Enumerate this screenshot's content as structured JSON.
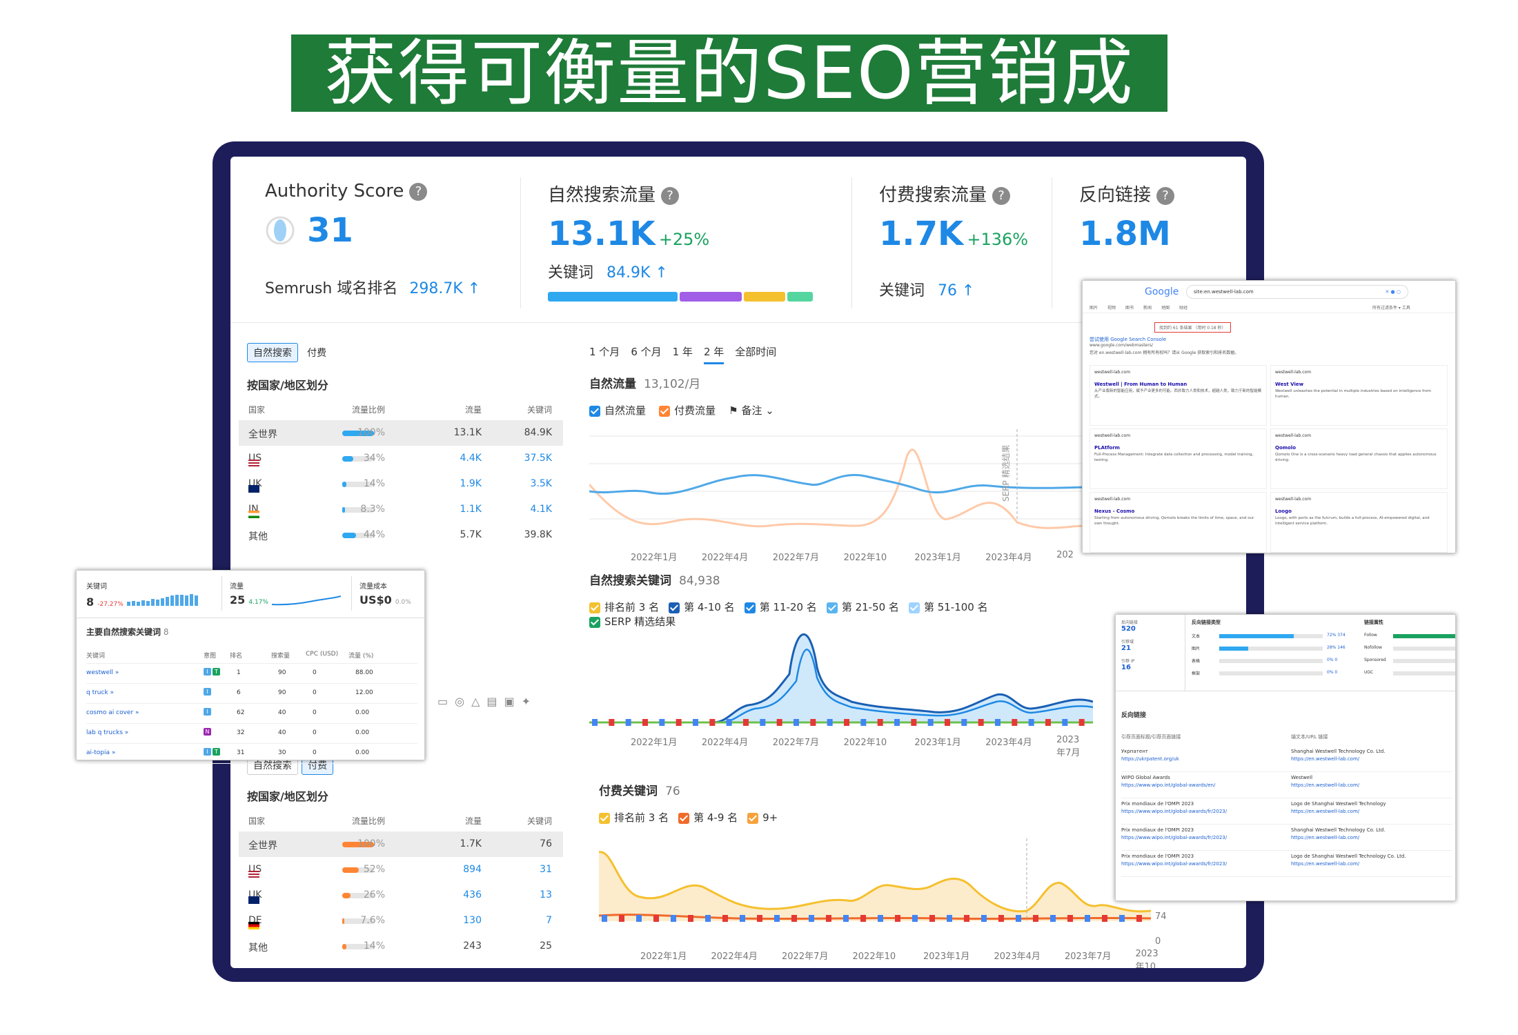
{
  "banner": {
    "title": "获得可衡量的SEO营销成果"
  },
  "colors": {
    "brand_green": "#1e7b38",
    "frame": "#1d1d5a",
    "accent_blue": "#1e88e5",
    "paid_orange": "#ff8534"
  },
  "metrics": {
    "authority": {
      "label": "Authority Score",
      "value": "31",
      "rank_label": "Semrush 域名排名",
      "rank_value": "298.7K"
    },
    "organic": {
      "label": "自然搜索流量",
      "value": "13.1K",
      "delta": "+25%",
      "kw_label": "关键词",
      "kw_value": "84.9K"
    },
    "paid": {
      "label": "付费搜索流量",
      "value": "1.7K",
      "delta": "+136%",
      "kw_label": "关键词",
      "kw_value": "76"
    },
    "backlinks": {
      "label": "反向链接",
      "value": "1.8M"
    },
    "organic_kw_bar": [
      {
        "color": "#2fa8f0",
        "share": 0.5
      },
      {
        "color": "#a15ee6",
        "share": 0.24
      },
      {
        "color": "#f5c02e",
        "share": 0.16
      },
      {
        "color": "#55d6a0",
        "share": 0.1
      }
    ]
  },
  "organic_table": {
    "tabs": [
      "自然搜索",
      "付费"
    ],
    "title": "按国家/地区划分",
    "headers": [
      "国家",
      "流量比例",
      "流量",
      "关键词"
    ],
    "rows": [
      {
        "country": "全世界",
        "flag": "",
        "share": "100%",
        "traffic": "13.1K",
        "keywords": "84.9K",
        "pct": 1.0
      },
      {
        "country": "US",
        "flag": "us",
        "share": "34%",
        "traffic": "4.4K",
        "keywords": "37.5K",
        "pct": 0.34
      },
      {
        "country": "UK",
        "flag": "uk",
        "share": "14%",
        "traffic": "1.9K",
        "keywords": "3.5K",
        "pct": 0.14
      },
      {
        "country": "IN",
        "flag": "in",
        "share": "8.3%",
        "traffic": "1.1K",
        "keywords": "4.1K",
        "pct": 0.083
      },
      {
        "country": "其他",
        "flag": "",
        "share": "44%",
        "traffic": "5.7K",
        "keywords": "39.8K",
        "pct": 0.44
      }
    ]
  },
  "paid_table": {
    "tabs": [
      "自然搜索",
      "付费"
    ],
    "title": "按国家/地区划分",
    "headers": [
      "国家",
      "流量比例",
      "流量",
      "关键词"
    ],
    "rows": [
      {
        "country": "全世界",
        "flag": "",
        "share": "100%",
        "traffic": "1.7K",
        "keywords": "76",
        "pct": 1.0
      },
      {
        "country": "US",
        "flag": "us",
        "share": "52%",
        "traffic": "894",
        "keywords": "31",
        "pct": 0.52
      },
      {
        "country": "UK",
        "flag": "uk",
        "share": "26%",
        "traffic": "436",
        "keywords": "13",
        "pct": 0.26
      },
      {
        "country": "DE",
        "flag": "de",
        "share": "7.6%",
        "traffic": "130",
        "keywords": "7",
        "pct": 0.076
      },
      {
        "country": "其他",
        "flag": "",
        "share": "14%",
        "traffic": "243",
        "keywords": "25",
        "pct": 0.14
      }
    ]
  },
  "time_tabs": [
    "1 个月",
    "6 个月",
    "1 年",
    "2 年",
    "全部时间"
  ],
  "time_tab_active": "2 年",
  "traffic_chart": {
    "title": "自然流量",
    "subtitle": "13,102/月",
    "legend": [
      "自然流量",
      "付费流量"
    ],
    "notes_label": "备注",
    "serp_label": "SERP 精选结果",
    "xlabels": [
      "2022年1月",
      "2022年4月",
      "2022年7月",
      "2022年10",
      "2023年1月",
      "2023年4月",
      "202"
    ]
  },
  "kw_chart": {
    "title": "自然搜索关键词",
    "subtitle": "84,938",
    "legend": [
      "排名前 3 名",
      "第 4-10 名",
      "第 11-20 名",
      "第 21-50 名",
      "第 51-100 名",
      "SERP 精选结果"
    ],
    "legend_colors": [
      "#f5c02e",
      "#1a5fb4",
      "#1e88e5",
      "#5ab4f0",
      "#9fd3ff",
      "#1aa260"
    ],
    "xlabels": [
      "2022年1月",
      "2022年4月",
      "2022年7月",
      "2022年10",
      "2023年1月",
      "2023年4月",
      "2023年7月"
    ]
  },
  "paid_kw_chart": {
    "title": "付费关键词",
    "subtitle": "76",
    "legend": [
      "排名前 3 名",
      "第 4-9 名",
      "9+"
    ],
    "legend_colors": [
      "#f5c02e",
      "#f06a2a",
      "#f7a23b"
    ],
    "xlabels": [
      "2022年1月",
      "2022年4月",
      "2022年7月",
      "2022年10",
      "2023年1月",
      "2023年4月",
      "2023年7月",
      "2023年10"
    ],
    "y_labels": [
      "74",
      "0"
    ]
  },
  "kw_popup": {
    "kw_label": "关键词",
    "kw_value": "8",
    "kw_delta": "-27.27%",
    "traffic_label": "流量",
    "traffic_value": "25",
    "traffic_delta": "4.17%",
    "cost_label": "流量成本",
    "cost_value": "US$0",
    "cost_delta": "0.0%",
    "section_title": "主要自然搜索关键词",
    "section_count": "8",
    "headers": [
      "关键词",
      "意图",
      "排名",
      "搜索量",
      "CPC (USD)",
      "流量 (%)"
    ],
    "rows": [
      {
        "kw": "westwell",
        "intent": [
          "I",
          "T"
        ],
        "pos": "1",
        "vol": "90",
        "cpc": "0",
        "traffic": "88.00"
      },
      {
        "kw": "q truck",
        "intent": [
          "I"
        ],
        "pos": "6",
        "vol": "90",
        "cpc": "0",
        "traffic": "12.00"
      },
      {
        "kw": "cosmo ai cover",
        "intent": [
          "I"
        ],
        "pos": "62",
        "vol": "40",
        "cpc": "0",
        "traffic": "0.00"
      },
      {
        "kw": "lab q trucks",
        "intent": [
          "N"
        ],
        "pos": "32",
        "vol": "40",
        "cpc": "0",
        "traffic": "0.00"
      },
      {
        "kw": "ai-topia",
        "intent": [
          "I",
          "T"
        ],
        "pos": "31",
        "vol": "30",
        "cpc": "0",
        "traffic": "0.00"
      }
    ]
  },
  "google_popup": {
    "logo": "Google",
    "query": "site:en.westwell-lab.com",
    "tabs": [
      "图片",
      "视频",
      "图书",
      "新闻",
      "地图",
      "财经"
    ],
    "tools": [
      "所有过滤条件",
      "工具"
    ],
    "result_count": "找到约 61 条结果 （用时 0.18 秒）",
    "console_link": "尝试使用 Google Search Console",
    "console_url": "www.google.com/webmasters/",
    "console_desc": "您对 en.westwell-lab.com 拥有所有权吗？请从 Google 获取索引和排名数据。",
    "results": [
      {
        "site": "westwell-lab.com",
        "title": "Westwell | From Human to Human",
        "desc": "从产业版新的智能应用，赋予产业更多的可能。西井致力人类和技术，超越人类，致力于新的智能模式。"
      },
      {
        "site": "westwell-lab.com",
        "title": "West View",
        "desc": "Westwell unleashes the potential in multiple industries based on intelligence from human."
      },
      {
        "site": "westwell-lab.com",
        "title": "PLAtform",
        "desc": "Full-Process Management: Integrate data collection and processing, model training, testing."
      },
      {
        "site": "westwell-lab.com",
        "title": "Qomolo",
        "desc": "Qomolo One is a cross-scenario heavy load general chassis that applies autonomous driving."
      },
      {
        "site": "westwell-lab.com",
        "title": "Nexus - Cosmo",
        "desc": "Starting from autonomous driving, Qomolo breaks the limits of time, space, and our own thought."
      },
      {
        "site": "westwell-lab.com",
        "title": "Loogo",
        "desc": "Loogo, with ports as the fulcrum, builds a full-process, AI-empowered digital, and intelligent service platform."
      }
    ]
  },
  "backlink_popup": {
    "stats": [
      {
        "label": "反向链接",
        "value": "520"
      },
      {
        "label": "引荐域",
        "value": "21"
      },
      {
        "label": "引荐 IP",
        "value": "16"
      }
    ],
    "type_title": "反向链接类型",
    "types": [
      {
        "name": "文本",
        "pct": "72%",
        "count": "374",
        "share": 0.72
      },
      {
        "name": "图片",
        "pct": "28%",
        "count": "146",
        "share": 0.28
      },
      {
        "name": "表格",
        "pct": "0%",
        "count": "0",
        "share": 0
      },
      {
        "name": "框架",
        "pct": "0%",
        "count": "0",
        "share": 0
      }
    ],
    "attr_title": "链接属性",
    "attrs": [
      {
        "name": "Follow",
        "share": 1.0
      },
      {
        "name": "Nofollow",
        "share": 0
      },
      {
        "name": "Sponsored",
        "share": 0
      },
      {
        "name": "UGC",
        "share": 0
      }
    ],
    "section_title": "反向链接",
    "headers": [
      "引荐页面标题/引荐页面链接",
      "锚文本/URL 链接"
    ],
    "rows": [
      {
        "title": "Укрпатент",
        "url": "https://ukrpatent.org/uk",
        "anchor": "Shanghai Westwell Technology Co. Ltd.",
        "target": "https://en.westwell-lab.com/"
      },
      {
        "title": "WIPO Global Awards",
        "url": "https://www.wipo.int/global-awards/en/",
        "anchor": "Westwell",
        "target": "https://en.westwell-lab.com/"
      },
      {
        "title": "Prix mondiaux de l'OMPI 2023",
        "url": "https://www.wipo.int/global-awards/fr/2023/",
        "anchor": "Logo de Shanghai Westwell Technology",
        "target": "https://en.westwell-lab.com/"
      },
      {
        "title": "Prix mondiaux de l'OMPI 2023",
        "url": "https://www.wipo.int/global-awards/fr/2023/",
        "anchor": "Shanghai Westwell Technology Co. Ltd.",
        "target": "https://en.westwell-lab.com/"
      },
      {
        "title": "Prix mondiaux de l'OMPI 2023",
        "url": "https://www.wipo.int/global-awards/fr/2023/",
        "anchor": "Logo de Shanghai Westwell Technology Co. Ltd.",
        "target": "https://en.westwell-lab.com/"
      }
    ]
  }
}
